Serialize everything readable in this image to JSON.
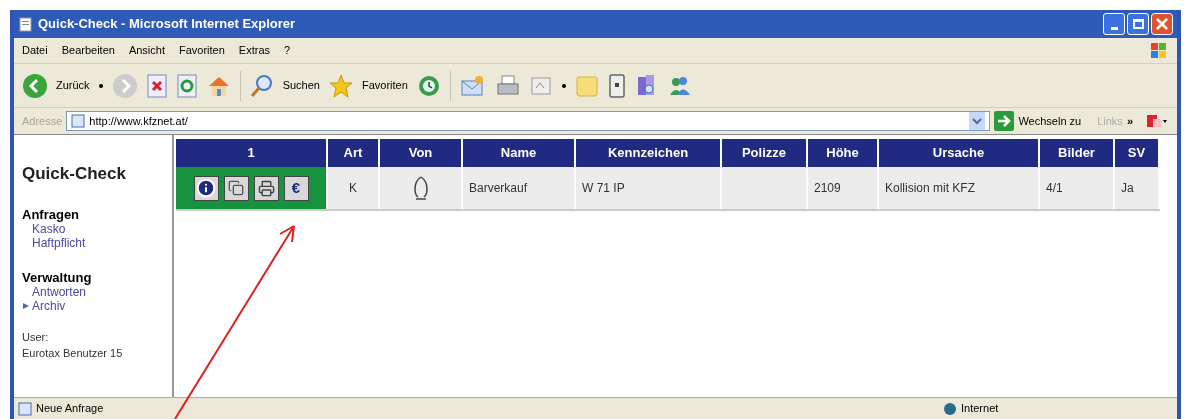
{
  "window": {
    "title": "Quick-Check - Microsoft Internet Explorer"
  },
  "menu": [
    "Datei",
    "Bearbeiten",
    "Ansicht",
    "Favoriten",
    "Extras",
    "?"
  ],
  "toolbar": {
    "back": "Zurück",
    "search": "Suchen",
    "favorites": "Favoriten"
  },
  "address": {
    "label": "Adresse",
    "url": "http://www.kfznet.at/",
    "go": "Wechseln zu",
    "links": "Links",
    "more": "»"
  },
  "sidebar": {
    "title": "Quick-Check",
    "sections": [
      {
        "heading": "Anfragen",
        "items": [
          {
            "label": "Kasko",
            "selected": false
          },
          {
            "label": "Haftpflicht",
            "selected": false
          }
        ]
      },
      {
        "heading": "Verwaltung",
        "items": [
          {
            "label": "Antworten",
            "selected": false
          },
          {
            "label": "Archiv",
            "selected": true
          }
        ]
      }
    ],
    "user_label": "User:",
    "user": "Eurotax Benutzer 15"
  },
  "table": {
    "columns": [
      "1",
      "Art",
      "Von",
      "Name",
      "Kennzeichen",
      "Polizze",
      "Höhe",
      "Ursache",
      "Bilder",
      "SV"
    ],
    "rows": [
      {
        "cells": [
          {
            "actions": [
              {
                "kind": "info"
              },
              {
                "kind": "copy"
              },
              {
                "kind": "print"
              },
              {
                "kind": "text",
                "label": "€"
              }
            ]
          },
          "K",
          "",
          "Barverkauf",
          "W 71 IP",
          "",
          "2109",
          "Kollision mit KFZ",
          "4/1",
          "Ja"
        ]
      }
    ]
  },
  "status_bar": {
    "text": "Neue Anfrage",
    "zone": "Internet"
  }
}
